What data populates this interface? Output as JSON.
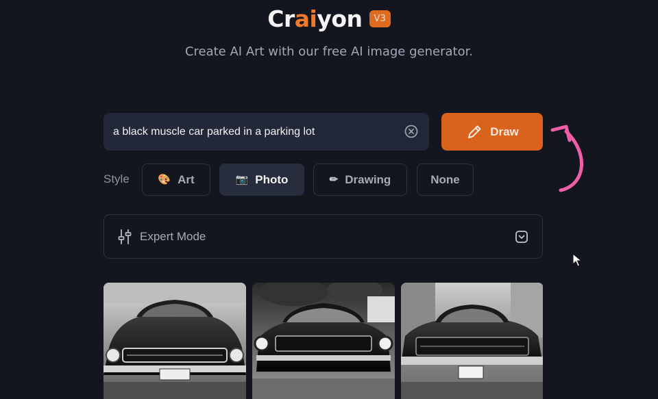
{
  "header": {
    "logo_prefix": "Cr",
    "logo_accent": "ai",
    "logo_suffix": "yon",
    "version": "V3",
    "subtitle": "Create AI Art with our free AI image generator."
  },
  "prompt": {
    "value": "a black muscle car parked in a parking lot",
    "clear_icon": "x-circle-icon"
  },
  "draw_button": {
    "label": "Draw",
    "icon": "pencil-icon"
  },
  "style": {
    "label": "Style",
    "options": [
      {
        "label": "Art",
        "icon": "palette-icon",
        "glyph": "🎨",
        "selected": false
      },
      {
        "label": "Photo",
        "icon": "camera-icon",
        "glyph": "📷",
        "selected": true
      },
      {
        "label": "Drawing",
        "icon": "pencil-icon",
        "glyph": "✏",
        "selected": false
      },
      {
        "label": "None",
        "icon": "",
        "glyph": "",
        "selected": false
      }
    ]
  },
  "expert_mode": {
    "label": "Expert Mode",
    "icon": "sliders-icon",
    "toggle_icon": "chevron-down-icon"
  },
  "results": [
    {
      "subject": "black muscle car front view",
      "plate": "",
      "style": "photo"
    },
    {
      "subject": "black muscle car front view",
      "plate": "",
      "style": "photo"
    },
    {
      "subject": "black muscle car front view",
      "plate": "",
      "style": "photo"
    }
  ],
  "colors": {
    "background": "#14161f",
    "accent": "#d9621c",
    "annotation": "#ee5fa8"
  }
}
